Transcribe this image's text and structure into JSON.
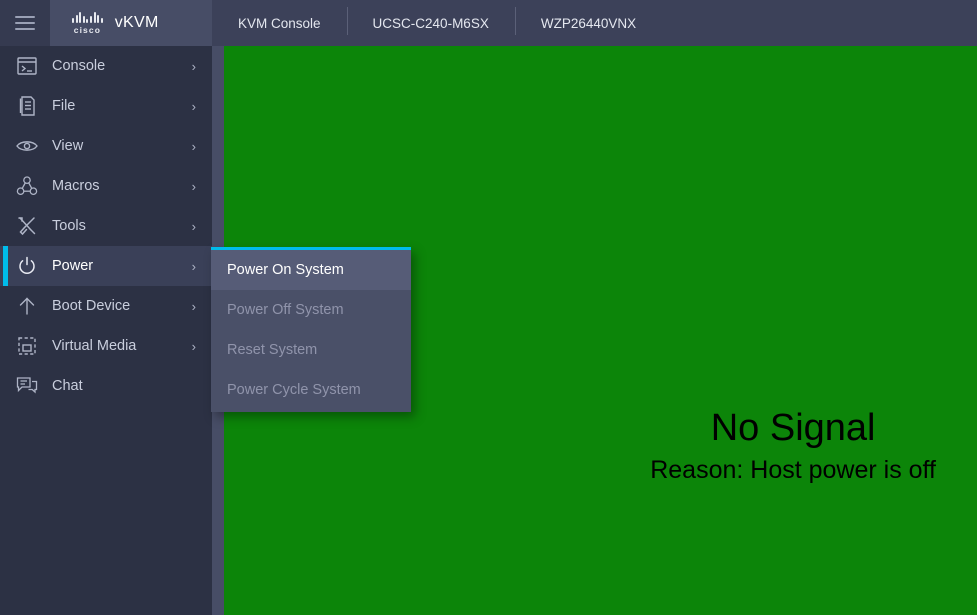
{
  "header": {
    "menu_icon": "hamburger-icon",
    "brand_logo": "cisco-logo",
    "brand_title": "vKVM",
    "info_items": [
      {
        "label": "KVM Console"
      },
      {
        "label": "UCSC-C240-M6SX"
      },
      {
        "label": "WZP26440VNX"
      }
    ]
  },
  "sidebar": {
    "items": [
      {
        "label": "Console",
        "icon": "terminal-icon",
        "chevron": "›",
        "has_submenu": true,
        "active": false
      },
      {
        "label": "File",
        "icon": "document-icon",
        "chevron": "›",
        "has_submenu": true,
        "active": false
      },
      {
        "label": "View",
        "icon": "eye-icon",
        "chevron": "›",
        "has_submenu": true,
        "active": false
      },
      {
        "label": "Macros",
        "icon": "macros-nodes-icon",
        "chevron": "›",
        "has_submenu": true,
        "active": false
      },
      {
        "label": "Tools",
        "icon": "tools-icon",
        "chevron": "›",
        "has_submenu": true,
        "active": false
      },
      {
        "label": "Power",
        "icon": "power-icon",
        "chevron": "›",
        "has_submenu": true,
        "active": true
      },
      {
        "label": "Boot Device",
        "icon": "arrow-up-icon",
        "chevron": "›",
        "has_submenu": true,
        "active": false
      },
      {
        "label": "Virtual Media",
        "icon": "dashed-square-icon",
        "chevron": "›",
        "has_submenu": true,
        "active": false
      },
      {
        "label": "Chat",
        "icon": "chat-bubble-icon",
        "chevron": "",
        "has_submenu": false,
        "active": false
      }
    ]
  },
  "power_submenu": {
    "items": [
      {
        "label": "Power On System",
        "disabled": false
      },
      {
        "label": "Power Off System",
        "disabled": true
      },
      {
        "label": "Reset System",
        "disabled": true
      },
      {
        "label": "Power Cycle System",
        "disabled": true
      }
    ]
  },
  "console": {
    "no_signal_title": "No Signal",
    "no_signal_reason": "Reason: Host power is off",
    "background_color": "#0c8509"
  },
  "colors": {
    "accent": "#00bceb",
    "header_bg": "#3c4159",
    "sidebar_bg": "#2c3144",
    "submenu_bg": "#4a5068",
    "screen_green": "#0c8509"
  }
}
